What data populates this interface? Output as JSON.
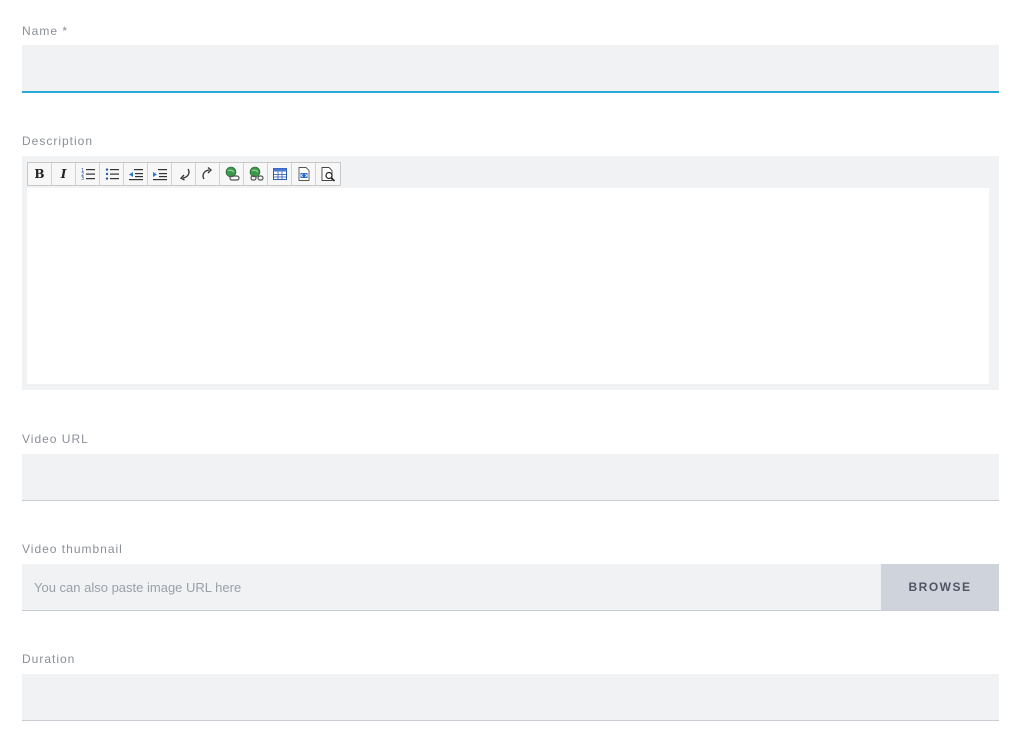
{
  "fields": {
    "name": {
      "label": "Name *",
      "value": ""
    },
    "description": {
      "label": "Description"
    },
    "video_url": {
      "label": "Video URL",
      "value": ""
    },
    "video_thumbnail": {
      "label": "Video thumbnail",
      "placeholder": "You can also paste image URL here",
      "browse_label": "BROWSE"
    },
    "duration": {
      "label": "Duration",
      "value": ""
    }
  },
  "editor": {
    "toolbar": {
      "bold": "B",
      "italic": "I",
      "icons": [
        "bold-icon",
        "italic-icon",
        "ordered-list-icon",
        "unordered-list-icon",
        "outdent-icon",
        "indent-icon",
        "undo-icon",
        "redo-icon",
        "link-icon",
        "unlink-icon",
        "table-icon",
        "html-source-icon",
        "preview-icon"
      ]
    }
  },
  "colors": {
    "focus_accent": "#2aa8d8",
    "field_bg": "#f1f2f4",
    "browse_bg": "#cfd3db",
    "label_text": "#8a8f98"
  }
}
